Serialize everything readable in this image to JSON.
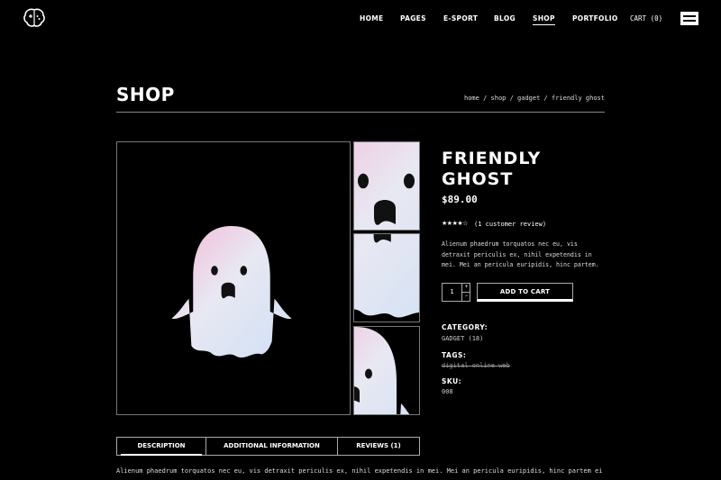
{
  "header": {
    "logo_icon": "brain-gamepad-icon",
    "nav": [
      {
        "label": "HOME",
        "active": false
      },
      {
        "label": "PAGES",
        "active": false
      },
      {
        "label": "E-SPORT",
        "active": false
      },
      {
        "label": "BLOG",
        "active": false
      },
      {
        "label": "SHOP",
        "active": true
      },
      {
        "label": "PORTFOLIO",
        "active": false
      }
    ],
    "cart_label": "CART (0)",
    "menu_icon": "hamburger-menu-icon"
  },
  "page": {
    "title": "SHOP",
    "breadcrumb": [
      "home",
      "shop",
      "gadget",
      "friendly ghost"
    ],
    "breadcrumb_separator": " / "
  },
  "gallery": {
    "main_image_alt": "pink ghost figure",
    "thumbnails": 3,
    "accent_colors": [
      "#f4b8d8",
      "#cfe0f5",
      "#e8e8f2"
    ]
  },
  "product": {
    "title": "FRIENDLY GHOST",
    "price": "$89.00",
    "rating": 4,
    "rating_max": 5,
    "review_link": "(1 customer review)",
    "description": "Alienum phaedrum torquatos nec eu, vis detraxit periculis ex, nihil expetendis in mei. Mei an pericula euripidis, hinc partem.",
    "quantity": "1",
    "add_to_cart": "ADD TO CART",
    "category_label": "CATEGORY:",
    "category_value": "GADGET (18)",
    "tags_label": "TAGS:",
    "tags_value": "digital online web",
    "sku_label": "SKU:",
    "sku_value": "008"
  },
  "tabs": {
    "items": [
      "DESCRIPTION",
      "ADDITIONAL INFORMATION",
      "REVIEWS (1)"
    ],
    "active_index": 0,
    "content": "Alienum phaedrum torquatos nec eu, vis detraxit periculis ex, nihil expetendis in mei. Mei an pericula euripidis, hinc partem ei"
  }
}
